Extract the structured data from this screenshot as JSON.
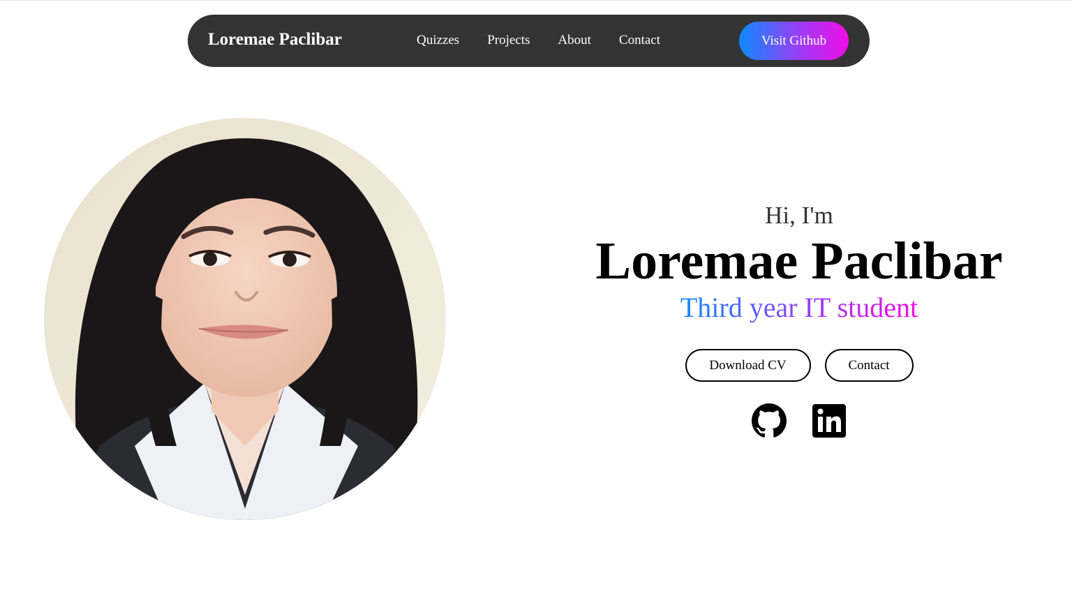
{
  "navbar": {
    "brand": "Loremae Paclibar",
    "links": [
      "Quizzes",
      "Projects",
      "About",
      "Contact"
    ],
    "cta_label": "Visit Github"
  },
  "hero": {
    "greeting": "Hi, I'm",
    "name": "Loremae Paclibar",
    "subtitle": "Third year IT student",
    "buttons": {
      "download_cv": "Download CV",
      "contact": "Contact"
    },
    "social": [
      "github-icon",
      "linkedin-icon"
    ]
  },
  "colors": {
    "navbar_bg": "#333333",
    "gradient_start": "#0d8bff",
    "gradient_mid": "#9b3df5",
    "gradient_end": "#f20ce8"
  }
}
